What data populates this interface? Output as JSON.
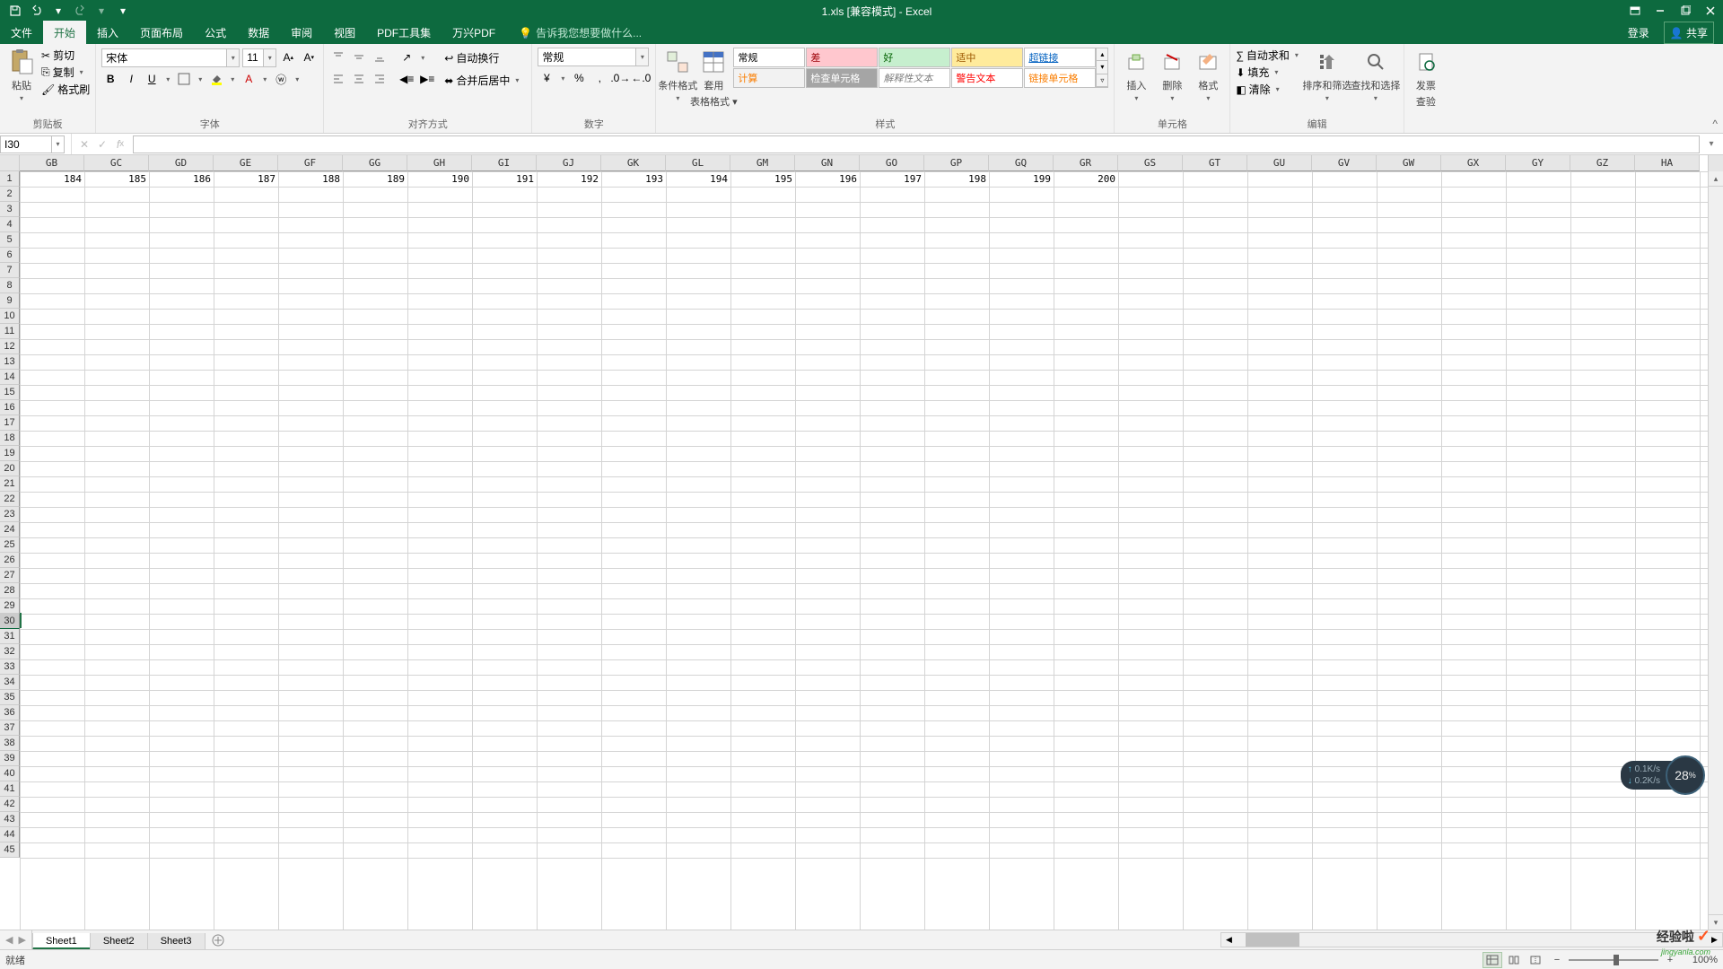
{
  "title": "1.xls  [兼容模式] - Excel",
  "tellme": "告诉我您想要做什么...",
  "login": "登录",
  "share": "共享",
  "tabs": {
    "file": "文件",
    "home": "开始",
    "insert": "插入",
    "layout": "页面布局",
    "formulas": "公式",
    "data": "数据",
    "review": "审阅",
    "view": "视图",
    "pdf": "PDF工具集",
    "wanxing": "万兴PDF"
  },
  "clipboard": {
    "paste": "粘贴",
    "cut": "剪切",
    "copy": "复制",
    "painter": "格式刷",
    "label": "剪贴板"
  },
  "font": {
    "name": "宋体",
    "size": "11",
    "label": "字体"
  },
  "align": {
    "wrap": "自动换行",
    "merge": "合并后居中",
    "label": "对齐方式"
  },
  "number": {
    "format": "常规",
    "label": "数字"
  },
  "styles": {
    "cf": "条件格式",
    "table": "套用",
    "table2": "表格格式",
    "normal": "常规",
    "bad": "差",
    "good": "好",
    "neutral": "适中",
    "link": "超链接",
    "calc": "计算",
    "check": "检查单元格",
    "explain": "解释性文本",
    "warn": "警告文本",
    "linked": "链接单元格",
    "label": "样式"
  },
  "cells": {
    "insert": "插入",
    "delete": "删除",
    "format": "格式",
    "label": "单元格"
  },
  "editing": {
    "autosum": "自动求和",
    "fill": "填充",
    "clear": "清除",
    "sort": "排序和筛选",
    "find": "查找和选择",
    "label": "编辑"
  },
  "invoice": {
    "line1": "发票",
    "line2": "查验"
  },
  "namebox": "I30",
  "columns": [
    "GB",
    "GC",
    "GD",
    "GE",
    "GF",
    "GG",
    "GH",
    "GI",
    "GJ",
    "GK",
    "GL",
    "GM",
    "GN",
    "GO",
    "GP",
    "GQ",
    "GR",
    "GS",
    "GT",
    "GU",
    "GV",
    "GW",
    "GX",
    "GY",
    "GZ",
    "HA"
  ],
  "row1_data": [
    184,
    185,
    186,
    187,
    188,
    189,
    190,
    191,
    192,
    193,
    194,
    195,
    196,
    197,
    198,
    199,
    200
  ],
  "active_row": 30,
  "sheets": {
    "s1": "Sheet1",
    "s2": "Sheet2",
    "s3": "Sheet3"
  },
  "status": "就绪",
  "zoom": "100%",
  "monitor": {
    "up": "0.1K/s",
    "down": "0.2K/s",
    "pct": "28"
  },
  "watermark": {
    "text": "经验啦",
    "sub": "jingyanla.com"
  }
}
